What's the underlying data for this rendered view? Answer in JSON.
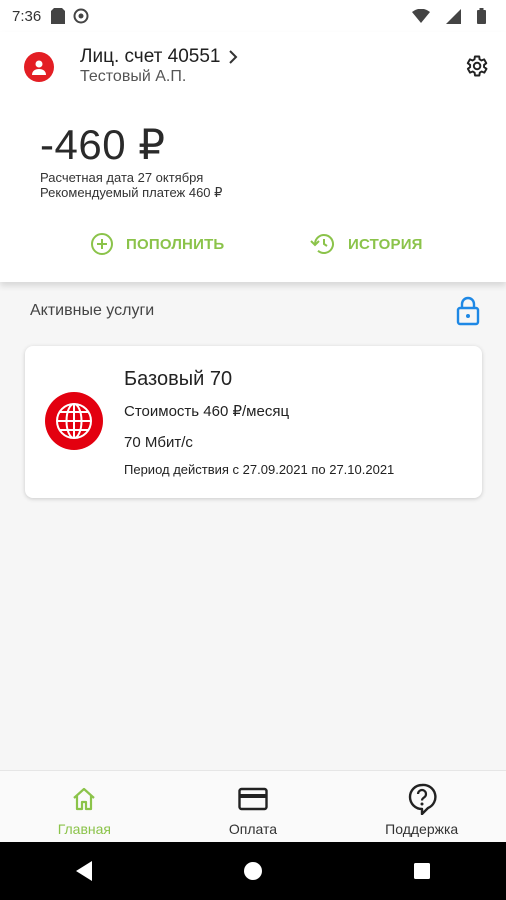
{
  "status_bar": {
    "time": "7:36",
    "icons": [
      "sd-card-icon",
      "location-icon",
      "wifi-icon",
      "signal-icon",
      "battery-icon"
    ]
  },
  "account": {
    "title": "Лиц. счет 40551",
    "holder": "Тестовый А.П.",
    "balance": "-460 ₽",
    "bill_date": "Расчетная дата 27 октября",
    "recommended": "Рекомендуемый платеж 460 ₽"
  },
  "actions": {
    "topup": "ПОПОЛНИТЬ",
    "history": "ИСТОРИЯ"
  },
  "services": {
    "section_title": "Активные услуги",
    "items": [
      {
        "name": "Базовый 70",
        "price": "Стоимость 460 ₽/месяц",
        "speed": "70  Мбит/с",
        "period": "Период действия с 27.09.2021 по 27.10.2021"
      }
    ]
  },
  "bottom_nav": {
    "items": [
      {
        "label": "Главная",
        "icon": "home-icon",
        "active": true
      },
      {
        "label": "Оплата",
        "icon": "card-icon",
        "active": false
      },
      {
        "label": "Поддержка",
        "icon": "support-icon",
        "active": false
      }
    ]
  },
  "colors": {
    "accent": "#8bc34a",
    "brand_red": "#e31e24",
    "lock_blue": "#1e88e5"
  }
}
